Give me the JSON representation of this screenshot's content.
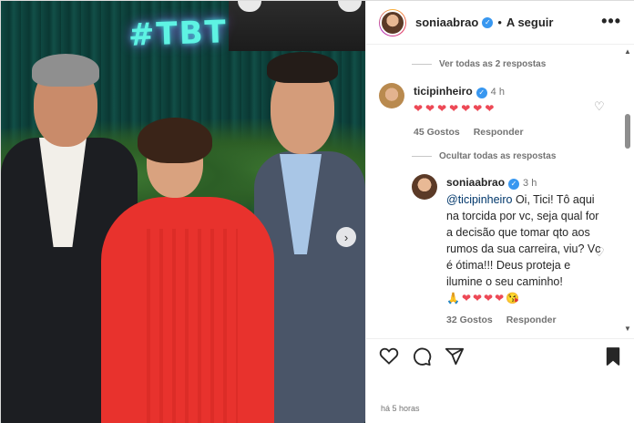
{
  "post": {
    "username": "soniaabrao",
    "follow_label": "A seguir",
    "more_label": "•••",
    "timestamp": "há 5 horas",
    "photo_sign": "#TBT",
    "next_arrow": "›"
  },
  "comments": {
    "view_replies_label": "Ver todas as 2 respostas",
    "hide_replies_label": "Ocultar todas as respostas",
    "items": [
      {
        "username": "ticipinheiro",
        "time": "4 h",
        "text": "❤❤❤❤❤❤❤",
        "likes": "45 Gostos",
        "reply_label": "Responder"
      },
      {
        "username": "soniaabrao",
        "time": "3 h",
        "mention": "@ticipinheiro",
        "text": "Oi, Tici! Tô aqui na torcida por vc, seja qual for a decisão que tomar qto aos rumos da sua carreira, viu? Vc é ótima!!! Deus proteja e ilumine o seu caminho!",
        "emoji_line": "🙏❤❤❤❤😘",
        "likes": "32 Gostos",
        "reply_label": "Responder"
      }
    ]
  },
  "icons": {
    "like": "heart-icon",
    "comment": "comment-icon",
    "share": "paper-plane-icon",
    "save": "bookmark-icon",
    "verified": "verified-badge-icon"
  },
  "colors": {
    "verified": "#3897f0",
    "heart": "#ed4956",
    "mention": "#00376b"
  }
}
